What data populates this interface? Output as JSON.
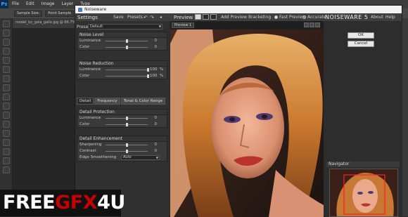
{
  "photoshop": {
    "logo": "Ps",
    "menu": [
      "File",
      "Edit",
      "Image",
      "Layer",
      "Type"
    ],
    "options": [
      "Sample Size:",
      "Point Sample"
    ],
    "doc_tab": "model_by_gala_gallo.jpg @ 66.7% (R"
  },
  "noiseware": {
    "window_title": "Noiseware",
    "header": {
      "settings": "Settings",
      "save": "Save",
      "presets": "Presets",
      "preview": "Preview",
      "add_preview": "Add Preview",
      "bracketing": "Bracketing",
      "fast_preview": "Fast Preview",
      "accurate": "Accurate",
      "brand": "NOISEWARE 5",
      "about": "About",
      "help": "Help"
    },
    "preset": {
      "label": "Preset",
      "value": "Default"
    },
    "noise_level": {
      "title": "Noise Level",
      "luminance": {
        "label": "Luminance",
        "value": "0",
        "level": 0.5
      },
      "color": {
        "label": "Color",
        "value": "0",
        "level": 0.5
      }
    },
    "noise_reduction": {
      "title": "Noise Reduction",
      "luminance": {
        "label": "Luminance",
        "value": "100",
        "unit": "%",
        "level": 1.0
      },
      "color": {
        "label": "Color",
        "value": "100",
        "unit": "%",
        "level": 1.0
      }
    },
    "tabs": [
      "Detail",
      "Frequency",
      "Tonal & Color Range"
    ],
    "detail_protection": {
      "title": "Detail Protection",
      "luminance": {
        "label": "Luminance",
        "value": "0",
        "level": 0.5
      },
      "color": {
        "label": "Color",
        "value": "0",
        "level": 0.5
      }
    },
    "detail_enhancement": {
      "title": "Detail Enhancement",
      "sharpening": {
        "label": "Sharpening",
        "value": "0",
        "level": 0.5
      },
      "contrast": {
        "label": "Contrast",
        "value": "0",
        "level": 0.5
      },
      "edge_smoothening": {
        "label": "Edge Smoothening",
        "value": "Auto"
      }
    },
    "preview_tab": "Preview 1",
    "buttons": {
      "ok": "OK",
      "cancel": "Cancel"
    },
    "navigator": "Navigator"
  },
  "watermark": {
    "free": "FREE",
    "gfx": "GFX",
    "four_u": "4U"
  }
}
